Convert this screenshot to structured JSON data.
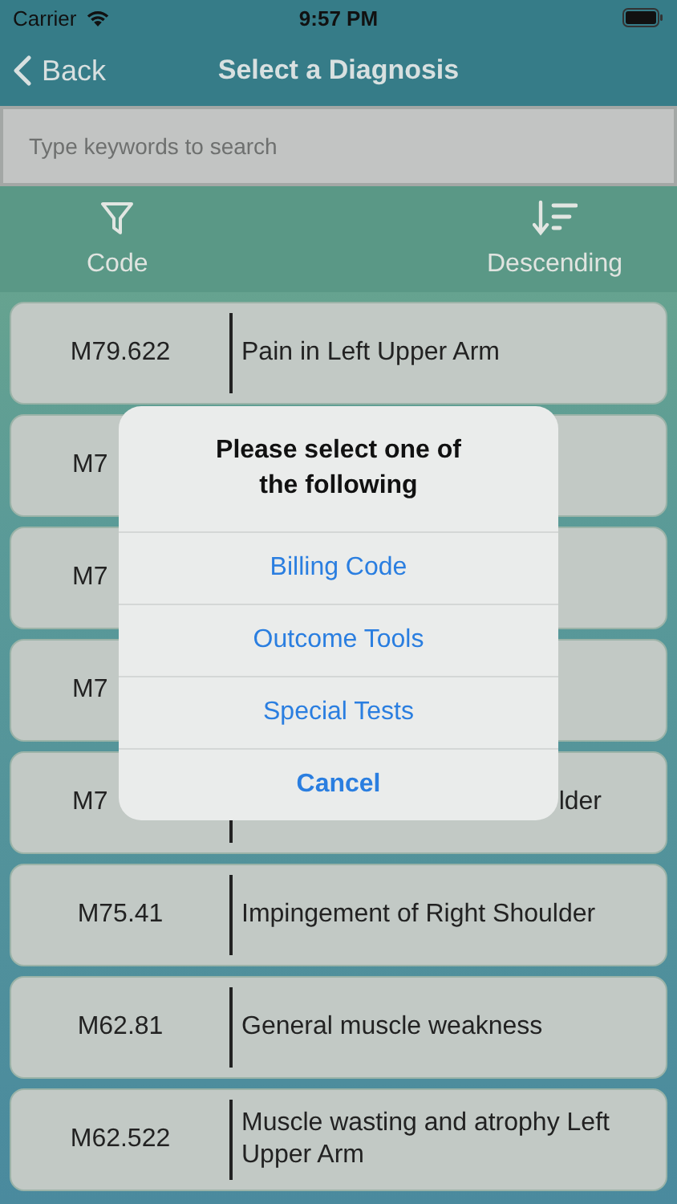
{
  "status_bar": {
    "carrier": "Carrier",
    "time": "9:57 PM"
  },
  "nav": {
    "back": "Back",
    "title": "Select a Diagnosis"
  },
  "search": {
    "placeholder": "Type keywords to search"
  },
  "toolbar": [
    {
      "kind": "filter",
      "label": "Code"
    },
    {
      "kind": "sort",
      "label": "Descending"
    }
  ],
  "rows": [
    {
      "kind": "full",
      "code": "M79.622",
      "description": "Pain in Left Upper Arm"
    },
    {
      "kind": "covered",
      "code": "M7"
    },
    {
      "kind": "covered",
      "code": "M7"
    },
    {
      "kind": "covered",
      "code": "M7"
    },
    {
      "kind": "covered",
      "code": "M7",
      "description": "lder"
    },
    {
      "kind": "full",
      "code": "M75.41",
      "description": "Impingement of Right Shoulder"
    },
    {
      "kind": "full",
      "code": "M62.81",
      "description": "General muscle weakness"
    },
    {
      "kind": "full",
      "code": "M62.522",
      "description": "Muscle wasting and atrophy Left Upper Arm"
    }
  ],
  "alert": {
    "title": "Please select one of the following",
    "actions": [
      {
        "label": "Billing Code",
        "kind": "default"
      },
      {
        "label": "Outcome Tools",
        "kind": "default"
      },
      {
        "label": "Special Tests",
        "kind": "default"
      },
      {
        "label": "Cancel",
        "kind": "cancel"
      }
    ]
  }
}
